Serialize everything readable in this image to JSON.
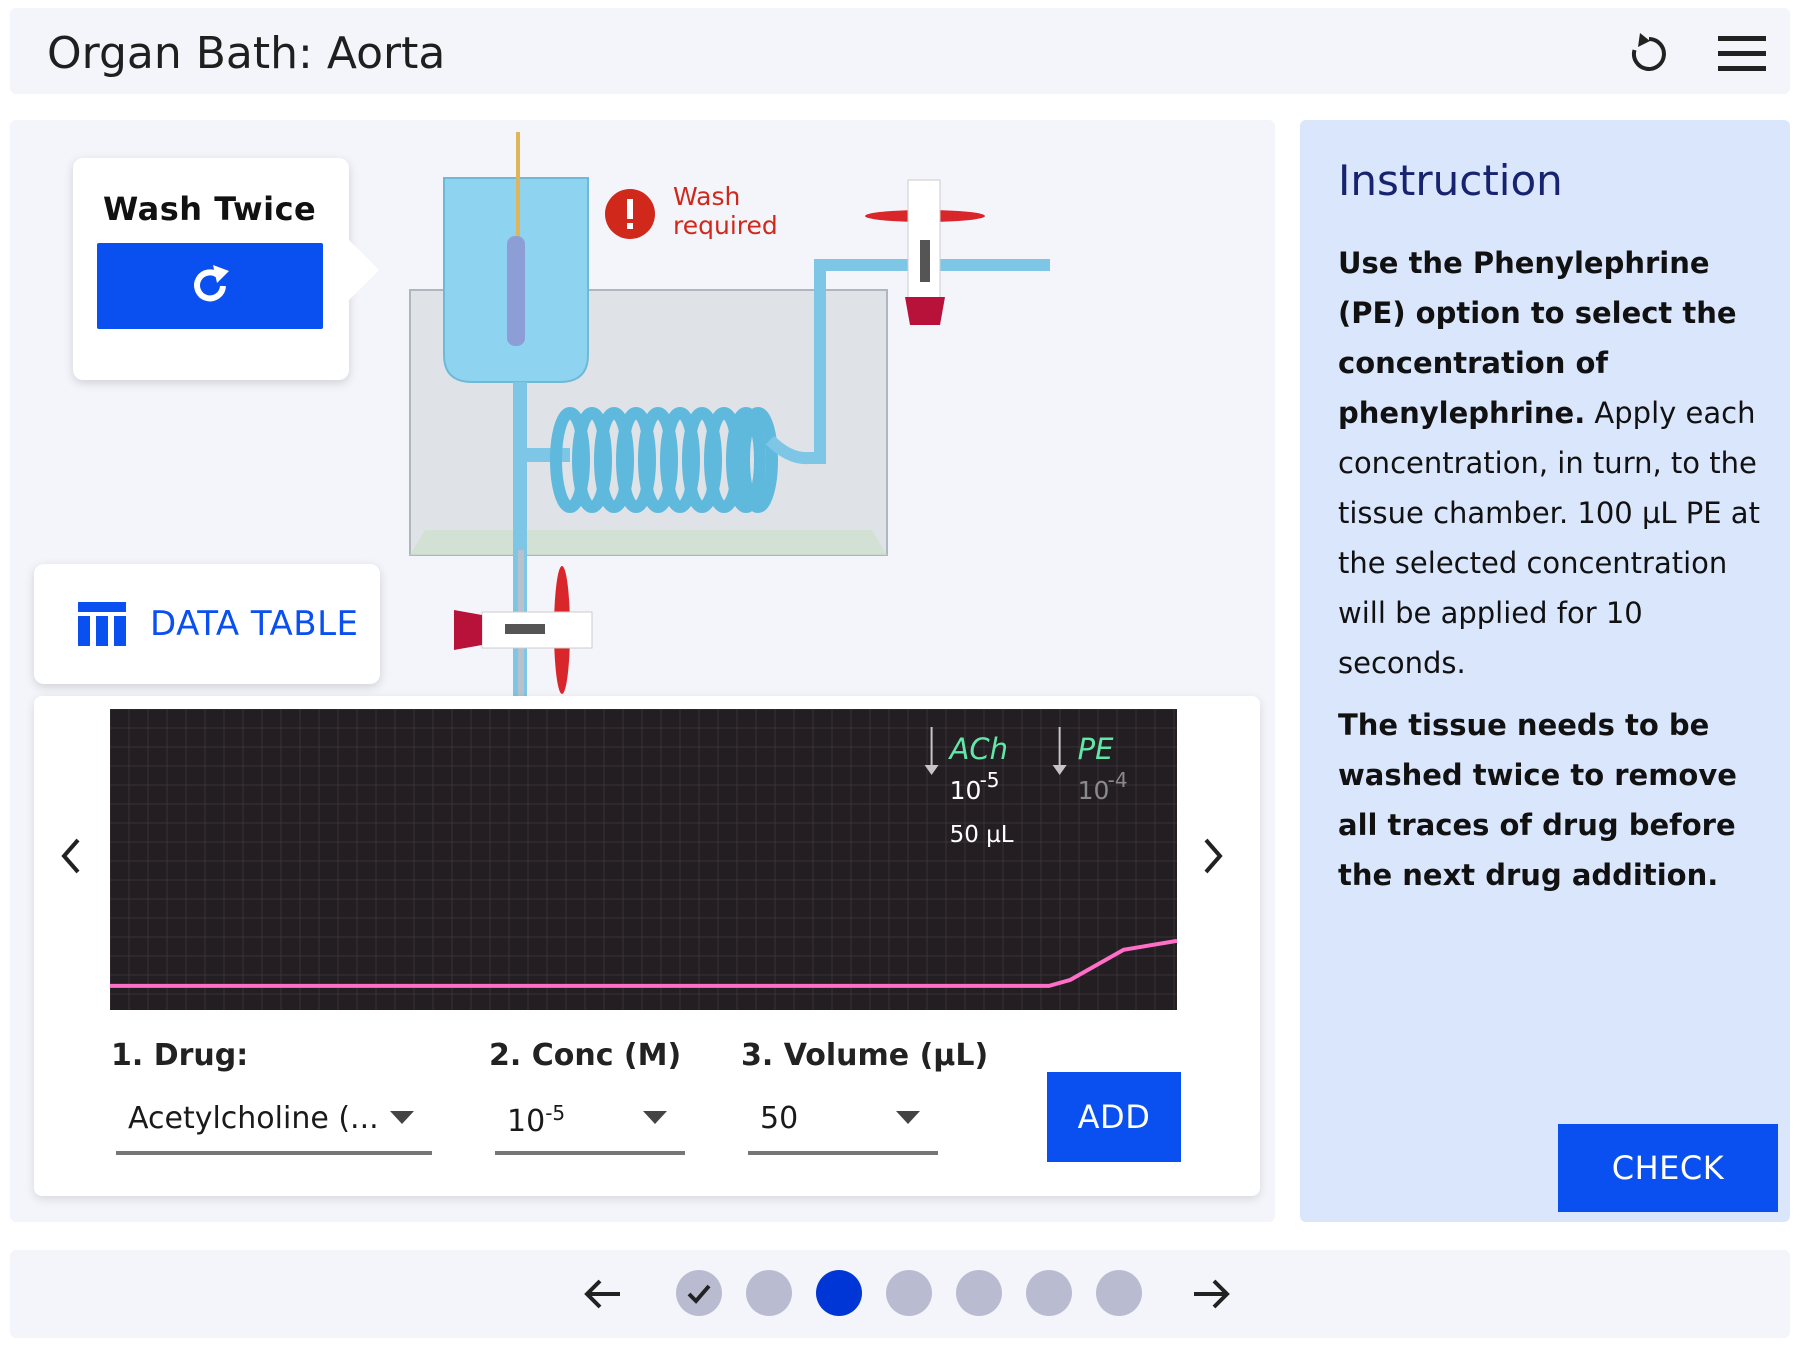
{
  "app": {
    "title": "Organ Bath: Aorta"
  },
  "header": {
    "reset_icon": "reset-icon",
    "menu_icon": "hamburger-menu-icon"
  },
  "wash_card": {
    "title": "Wash Twice",
    "button_icon": "refresh-icon"
  },
  "wash_alert": {
    "icon": "exclamation-icon",
    "text": "Wash required",
    "color": "#d0281b"
  },
  "data_table": {
    "label": "DATA TABLE",
    "icon": "table-icon"
  },
  "chart_data": {
    "type": "line",
    "title": "",
    "xlabel": "",
    "ylabel": "",
    "background": "#231e22",
    "series": [
      {
        "color": "#ff6ec7",
        "x": [
          0,
          0.88,
          0.9,
          0.95,
          1.0
        ],
        "y": [
          0.08,
          0.08,
          0.1,
          0.2,
          0.23
        ]
      }
    ],
    "markers": [
      {
        "drug": "ACh",
        "conc_base": "10",
        "conc_exp": "-5",
        "volume": "50 µL",
        "color": "#61e8a8",
        "x": 0.77
      },
      {
        "drug": "PE",
        "conc_base": "10",
        "conc_exp": "-4",
        "volume": "",
        "color": "#61e8a8",
        "x": 0.89
      }
    ]
  },
  "chart_nav": {
    "prev_icon": "chevron-left-icon",
    "next_icon": "chevron-right-icon"
  },
  "controls": {
    "drug_label": "1. Drug:",
    "drug_value": "Acetylcholine (...",
    "conc_label": "2. Conc (M)",
    "conc_base": "10",
    "conc_exp": "-5",
    "volume_label": "3. Volume (µL)",
    "volume_value": "50",
    "add_label": "ADD"
  },
  "instruction": {
    "title": "Instruction",
    "p1_bold": "Use the Phenylephrine (PE) option to select the concentration of phenylephrine.",
    "p1_rest": " Apply each concentration, in turn, to the tissue chamber. 100 µL PE at the selected concentration will be applied for 10 seconds.",
    "p2_bold": "The tissue needs to be washed twice to remove all traces of drug before the next drug addition.",
    "check_label": "CHECK"
  },
  "pager": {
    "back_icon": "arrow-left-icon",
    "forward_icon": "arrow-right-icon",
    "steps": [
      {
        "state": "done",
        "icon": "checkmark-icon"
      },
      {
        "state": "pending"
      },
      {
        "state": "current"
      },
      {
        "state": "pending"
      },
      {
        "state": "pending"
      },
      {
        "state": "pending"
      },
      {
        "state": "pending"
      }
    ],
    "active_color": "#0036d6"
  }
}
